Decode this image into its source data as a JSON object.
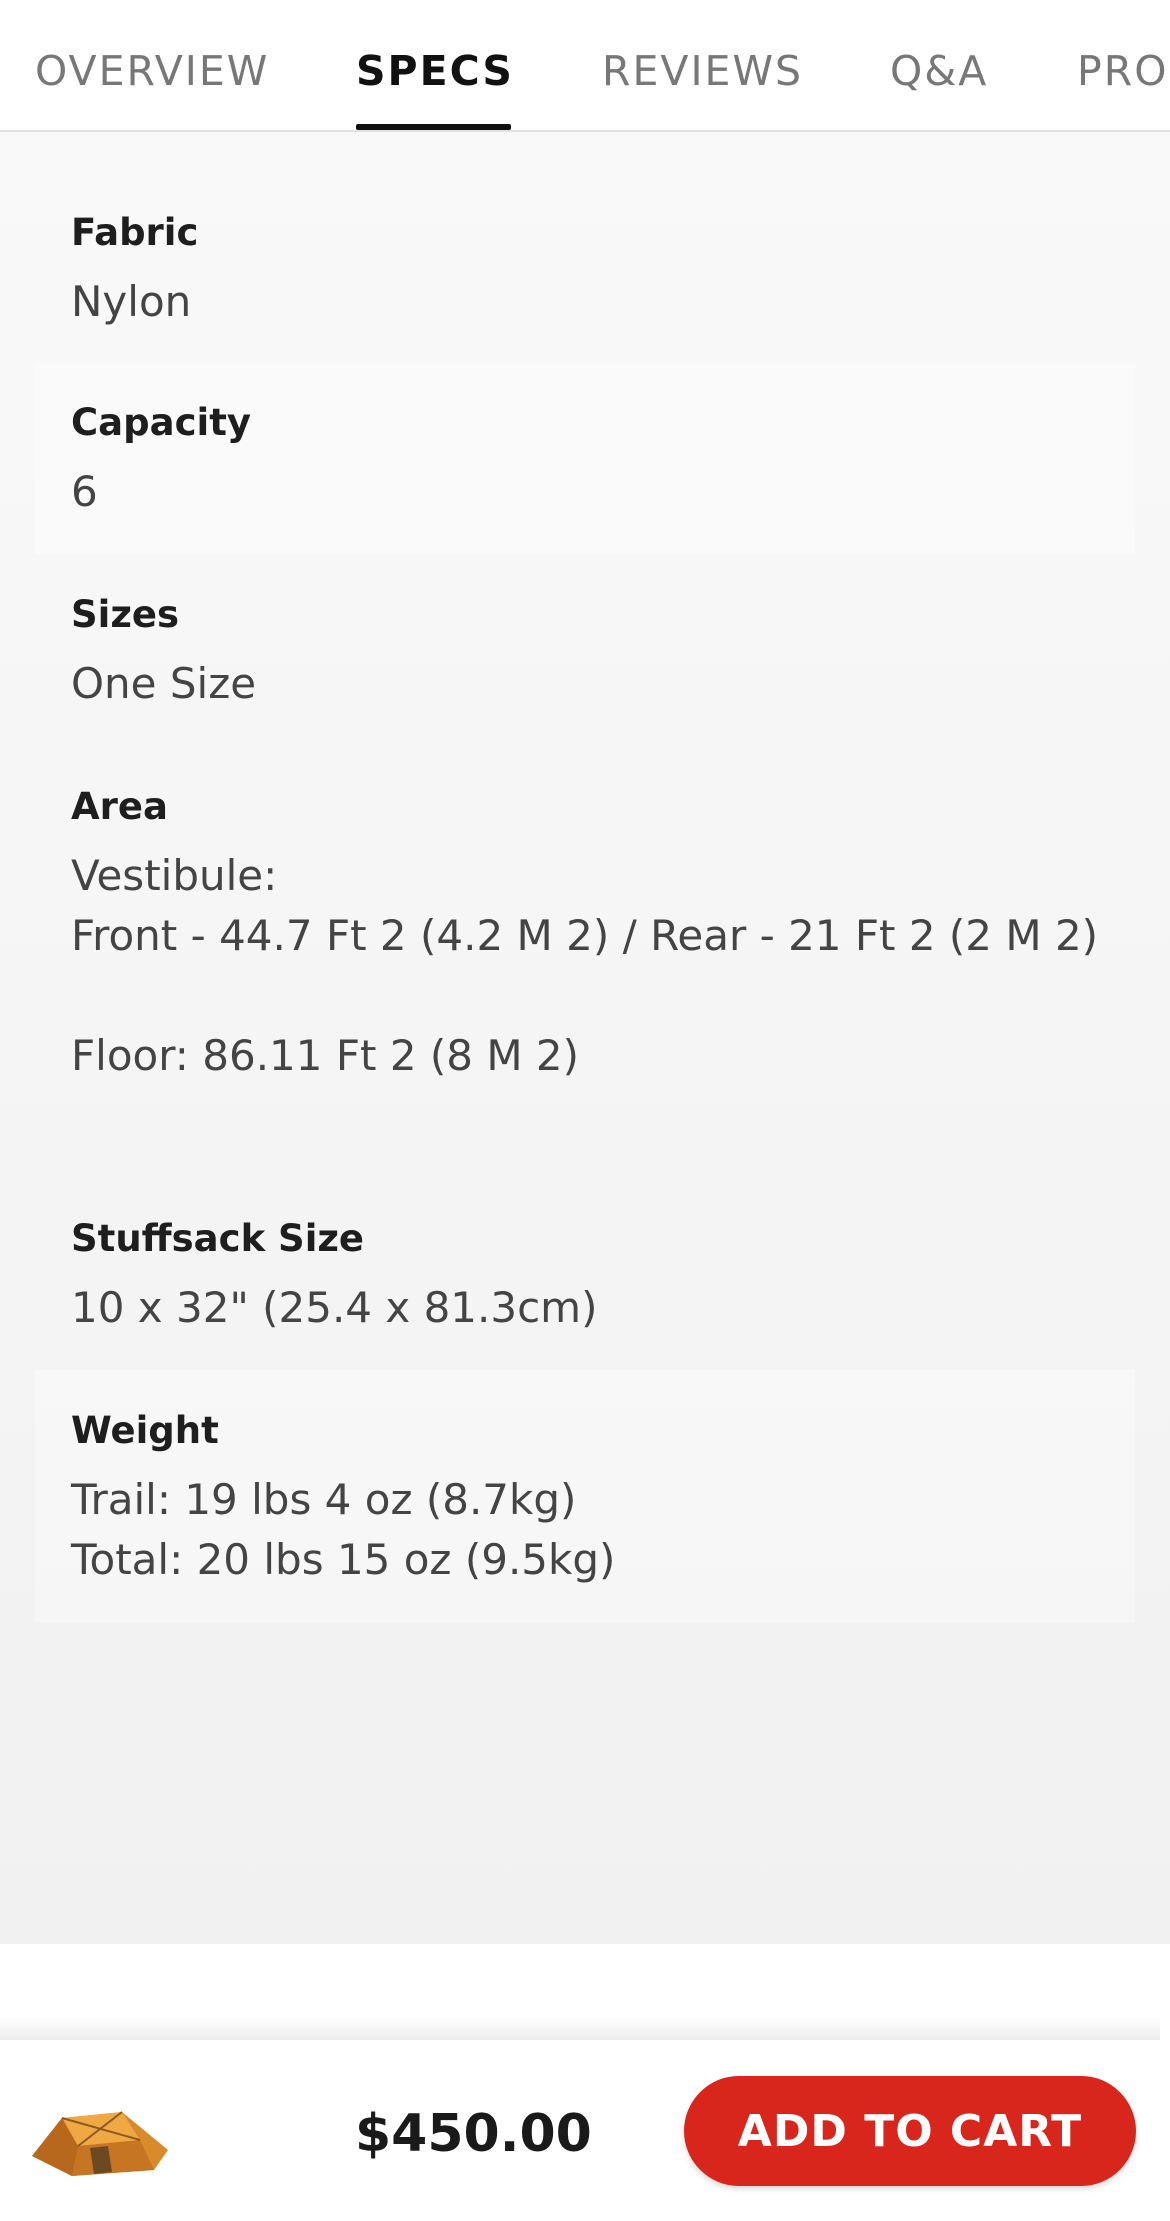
{
  "tabs": [
    {
      "label": "OVERVIEW",
      "active": false
    },
    {
      "label": "SPECS",
      "active": true
    },
    {
      "label": "REVIEWS",
      "active": false
    },
    {
      "label": "Q&A",
      "active": false
    },
    {
      "label": "PRO",
      "active": false
    }
  ],
  "specs": [
    {
      "label": "Fabric",
      "value": "Nylon"
    },
    {
      "label": "Capacity",
      "value": "6"
    },
    {
      "label": "Sizes",
      "value": "One Size"
    },
    {
      "label": "Area",
      "value": "Vestibule:\nFront - 44.7 Ft 2 (4.2 M 2) / Rear - 21 Ft 2 (2 M 2)\n\nFloor: 86.11 Ft 2 (8 M 2)"
    },
    {
      "label": "Stuffsack Size",
      "value": "10 x 32\" (25.4 x 81.3cm)"
    },
    {
      "label": "Weight",
      "value": "Trail: 19 lbs 4 oz (8.7kg)\nTotal: 20 lbs 15 oz (9.5kg)"
    }
  ],
  "bottom_bar": {
    "product_icon": "tent-thumbnail",
    "price": "$450.00",
    "add_to_cart_label": "ADD TO CART"
  },
  "colors": {
    "accent_red": "#d9261c",
    "active_tab": "#111111"
  }
}
